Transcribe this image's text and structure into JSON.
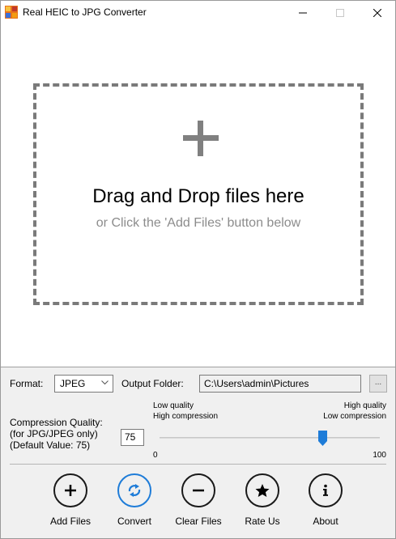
{
  "window": {
    "title": "Real HEIC to JPG Converter"
  },
  "drop_zone": {
    "title": "Drag and Drop files here",
    "subtitle": "or Click the 'Add Files' button below"
  },
  "settings": {
    "format_label": "Format:",
    "format_value": "JPEG",
    "output_folder_label": "Output Folder:",
    "output_folder_value": "C:\\Users\\admin\\Pictures",
    "browse_label": "...",
    "compression_label_1": "Compression Quality:",
    "compression_label_2": "(for JPG/JPEG only)",
    "compression_label_3": "(Default Value: 75)",
    "quality_value": "75",
    "low_quality": "Low quality",
    "high_compression": "High compression",
    "high_quality": "High quality",
    "low_compression": "Low compression",
    "slider_min": "0",
    "slider_max": "100",
    "slider_value": 75
  },
  "actions": [
    {
      "label": "Add Files",
      "icon": "plus-icon"
    },
    {
      "label": "Convert",
      "icon": "convert-arrows-icon",
      "active": true
    },
    {
      "label": "Clear Files",
      "icon": "minus-icon"
    },
    {
      "label": "Rate Us",
      "icon": "star-icon"
    },
    {
      "label": "About",
      "icon": "info-icon"
    }
  ],
  "colors": {
    "accent": "#1e7cd8",
    "panel_bg": "#f0f0f0",
    "dash": "#7a7a7a"
  }
}
